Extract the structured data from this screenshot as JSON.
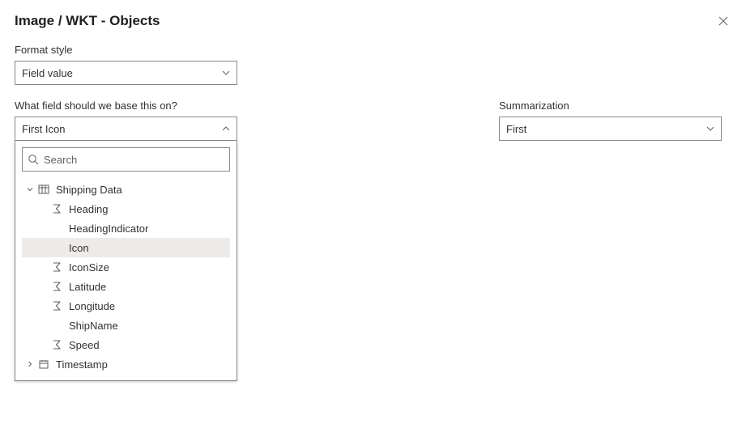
{
  "title": "Image / WKT - Objects",
  "formatStyle": {
    "label": "Format style",
    "value": "Field value"
  },
  "fieldBasis": {
    "label": "What field should we base this on?",
    "value": "First Icon",
    "searchPlaceholder": "Search",
    "tree": {
      "table": "Shipping Data",
      "items": [
        {
          "label": "Heading",
          "icon": "sigma"
        },
        {
          "label": "HeadingIndicator",
          "icon": null
        },
        {
          "label": "Icon",
          "icon": null,
          "selected": true
        },
        {
          "label": "IconSize",
          "icon": "sigma"
        },
        {
          "label": "Latitude",
          "icon": "sigma"
        },
        {
          "label": "Longitude",
          "icon": "sigma"
        },
        {
          "label": "ShipName",
          "icon": null
        },
        {
          "label": "Speed",
          "icon": "sigma"
        }
      ],
      "hierarchy": {
        "label": "Timestamp",
        "icon": "calendar"
      }
    }
  },
  "summarization": {
    "label": "Summarization",
    "value": "First"
  }
}
